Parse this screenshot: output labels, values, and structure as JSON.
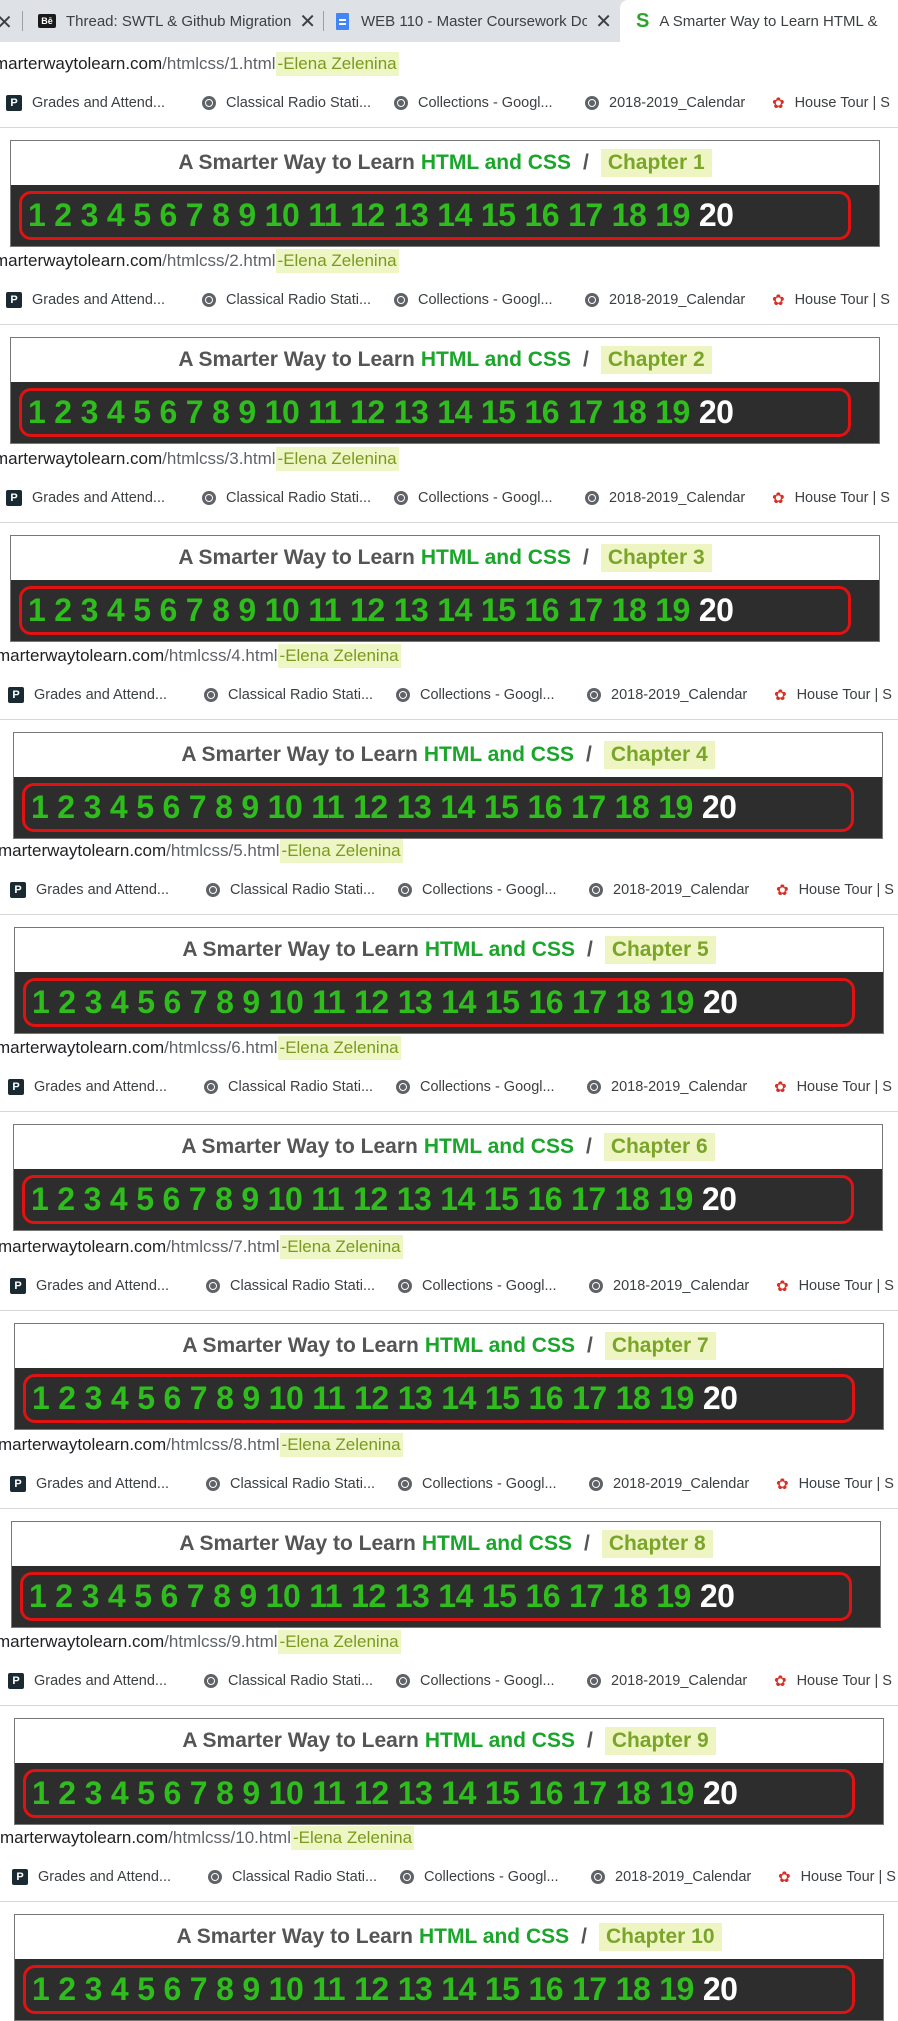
{
  "tabs": [
    {
      "title": "Thread: SWTL & Github Migration",
      "icon": "behance-icon",
      "active": false
    },
    {
      "title": "WEB 110 - Master Coursework Do",
      "icon": "google-docs-icon",
      "active": false
    },
    {
      "title": "A Smarter Way to Learn HTML &",
      "icon": "smarter-way-icon",
      "active": true
    }
  ],
  "tab_close_glyph": "✕",
  "bookmarks": [
    {
      "label": "Grades and Attend...",
      "icon": "powerschool-icon"
    },
    {
      "label": "Classical Radio Stati...",
      "icon": "globe-icon"
    },
    {
      "label": "Collections - Googl...",
      "icon": "globe-icon"
    },
    {
      "label": "2018-2019_Calendar",
      "icon": "globe-icon"
    },
    {
      "label": "House Tour | S",
      "icon": "house-tour-icon"
    }
  ],
  "url_host": "marterwaytolearn.com",
  "student_name": "-Elena Zelenina",
  "header": {
    "title_prefix": "A Smarter Way to Learn",
    "title_highlight": "HTML and CSS",
    "separator": "/"
  },
  "numbers": [
    "1",
    "2",
    "3",
    "4",
    "5",
    "6",
    "7",
    "8",
    "9",
    "10",
    "11",
    "12",
    "13",
    "14",
    "15",
    "16",
    "17",
    "18",
    "19",
    "20"
  ],
  "colors": {
    "accent_green": "#1aa62a",
    "number_green": "#2fbd1e",
    "border_red": "#e01212",
    "bar_dark": "#2d2d2d"
  },
  "sections": [
    {
      "url_path": "/htmlcss/1.html",
      "chapter": "Chapter 1"
    },
    {
      "url_path": "/htmlcss/2.html",
      "chapter": "Chapter 2"
    },
    {
      "url_path": "/htmlcss/3.html",
      "chapter": "Chapter 3"
    },
    {
      "url_path": "/htmlcss/4.html",
      "chapter": "Chapter 4"
    },
    {
      "url_path": "/htmlcss/5.html",
      "chapter": "Chapter 5"
    },
    {
      "url_path": "/htmlcss/6.html",
      "chapter": "Chapter 6"
    },
    {
      "url_path": "/htmlcss/7.html",
      "chapter": "Chapter 7"
    },
    {
      "url_path": "/htmlcss/8.html",
      "chapter": "Chapter 8"
    },
    {
      "url_path": "/htmlcss/9.html",
      "chapter": "Chapter 9"
    },
    {
      "url_path": "/htmlcss/10.html",
      "chapter": "Chapter 10"
    }
  ]
}
